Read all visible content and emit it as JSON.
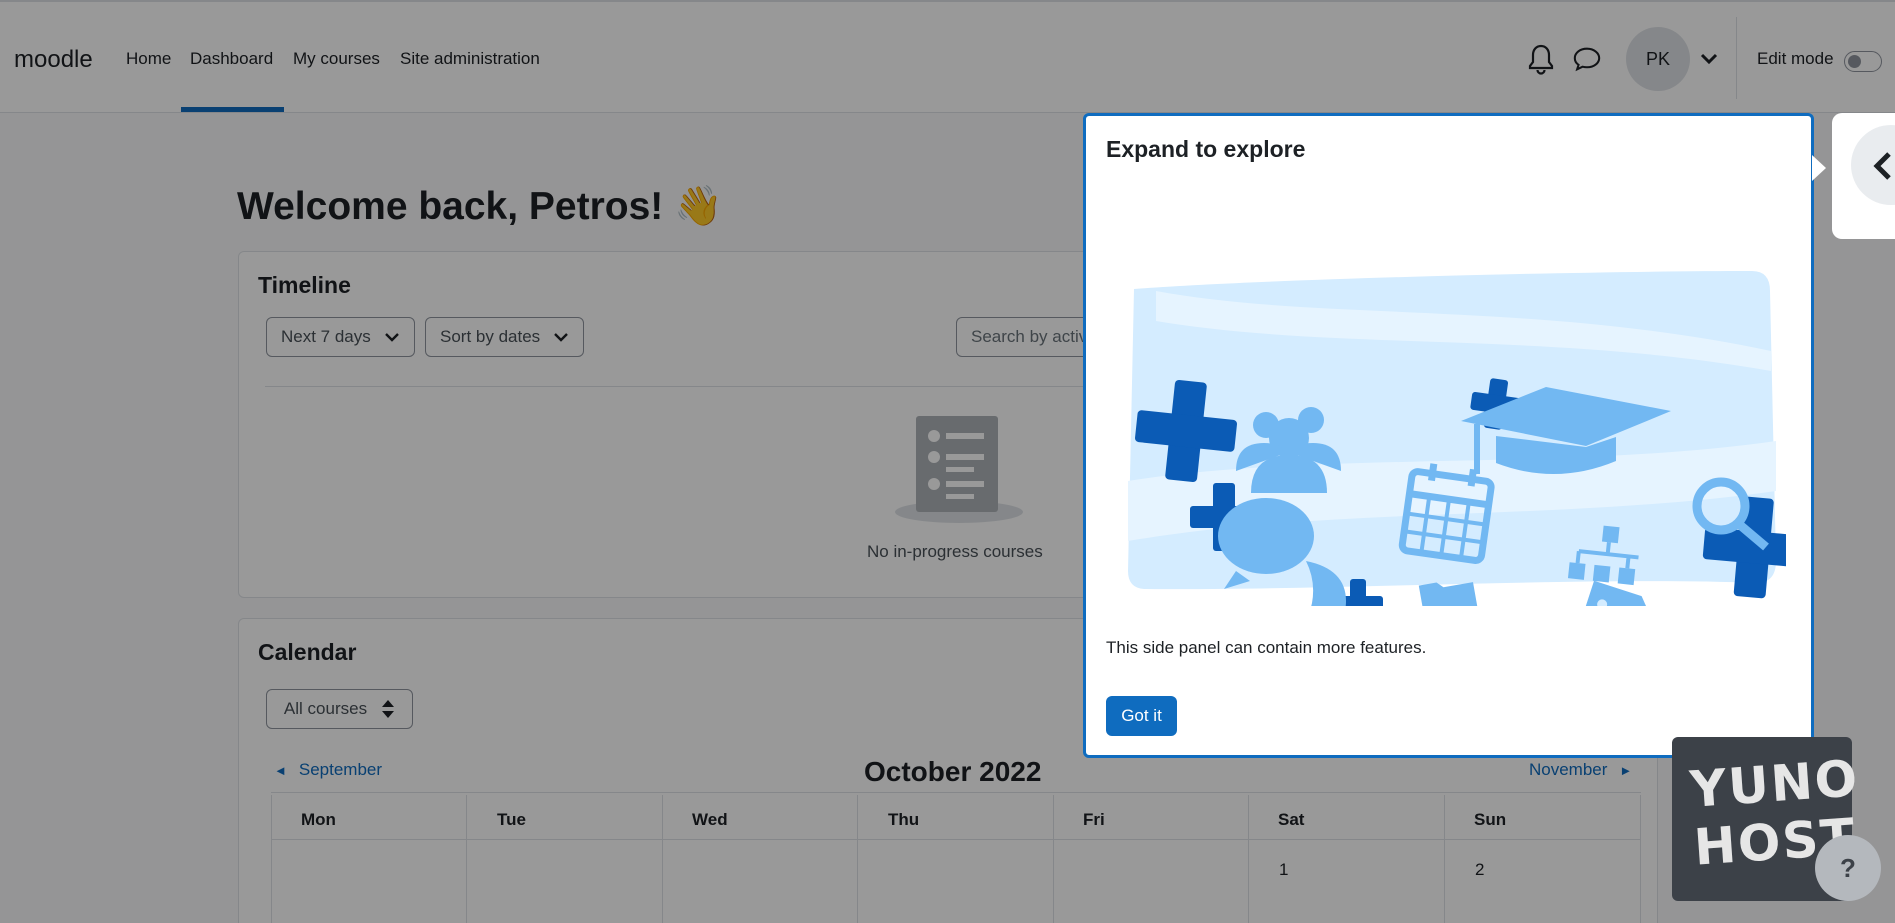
{
  "navbar": {
    "brand": "moodle",
    "links": [
      "Home",
      "Dashboard",
      "My courses",
      "Site administration"
    ],
    "active": "Dashboard",
    "user_initials": "PK",
    "edit_mode_label": "Edit mode",
    "edit_mode_on": false
  },
  "page": {
    "welcome": "Welcome back, Petros! 👋"
  },
  "timeline": {
    "title": "Timeline",
    "filter_label": "Next 7 days",
    "sort_label": "Sort by dates",
    "search_placeholder": "Search by activity type or name",
    "empty_text": "No in-progress courses"
  },
  "calendar": {
    "title": "Calendar",
    "course_filter": "All courses",
    "prev_month": "September",
    "month_title": "October 2022",
    "next_month": "November",
    "prev_arrow": "◄",
    "next_arrow": "►",
    "weekdays": [
      "Mon",
      "Tue",
      "Wed",
      "Thu",
      "Fri",
      "Sat",
      "Sun"
    ],
    "first_row": [
      "",
      "",
      "",
      "",
      "",
      "1",
      "2"
    ]
  },
  "tour": {
    "title": "Expand to explore",
    "body": "This side panel can contain more features.",
    "button": "Got it"
  },
  "yunohost": {
    "line1": "YUNO",
    "line2": "HOST",
    "help": "?"
  },
  "colors": {
    "primary": "#0f6cbf",
    "illustration_light": "#d4ecff",
    "illustration_mid": "#72b8f2",
    "illustration_dark": "#0b5bb5"
  }
}
